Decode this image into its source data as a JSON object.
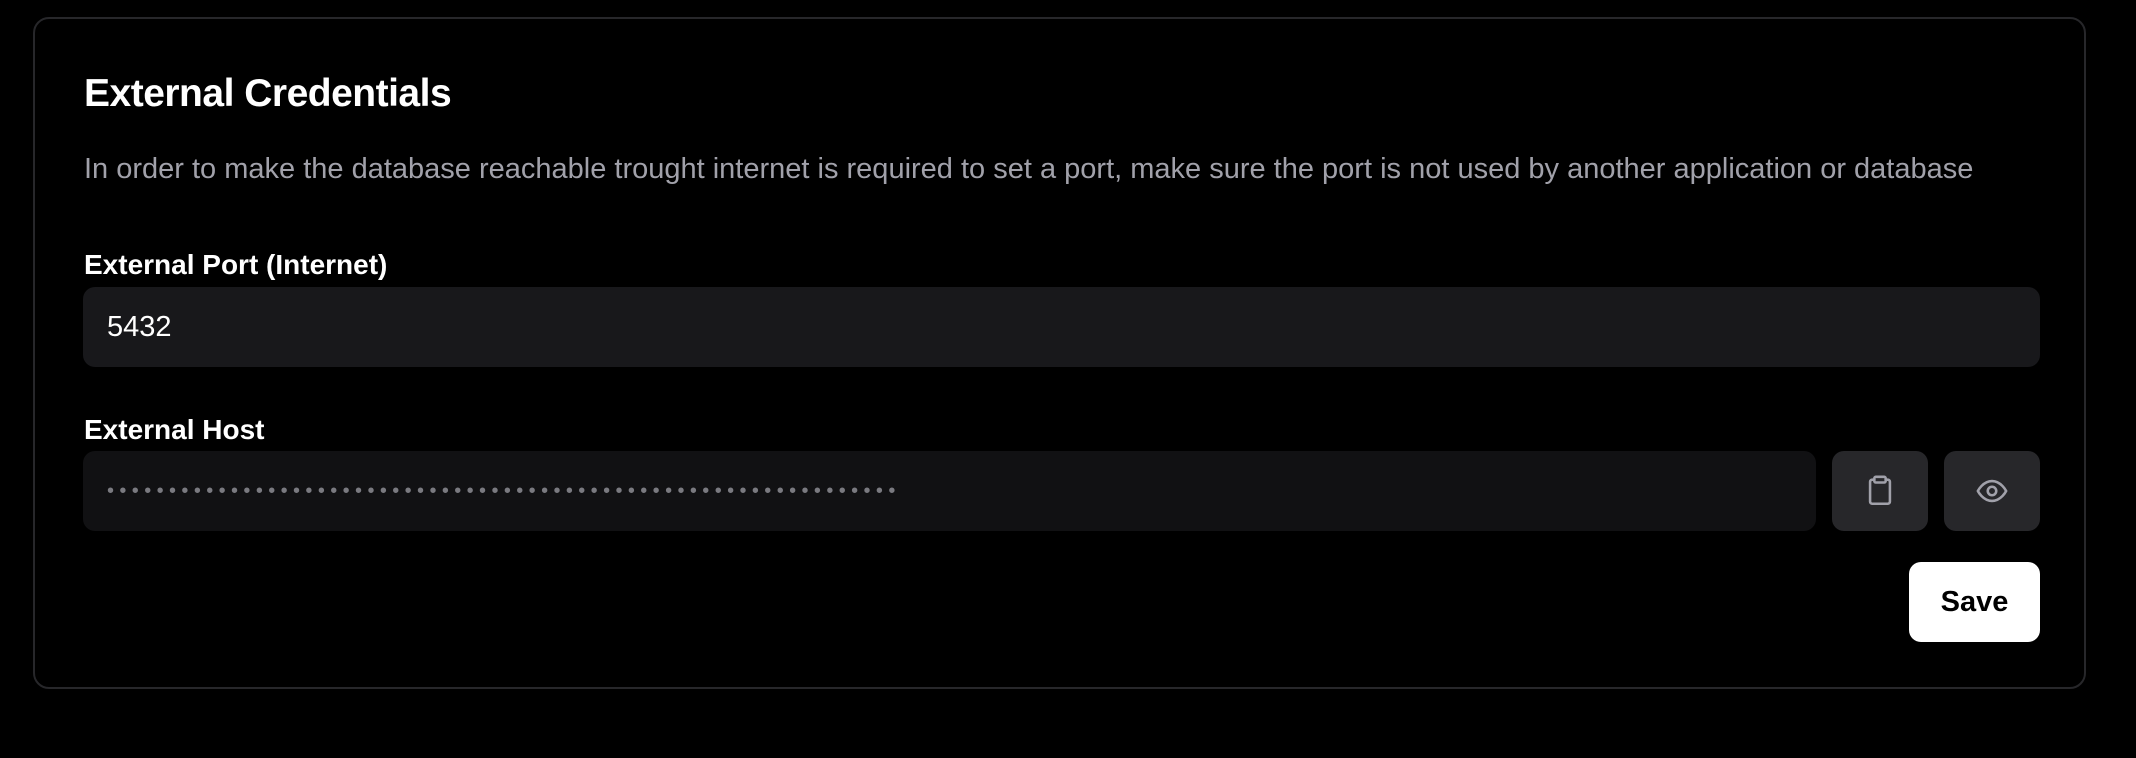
{
  "section": {
    "title": "External Credentials",
    "description": "In order to make the database reachable trought internet is required to set a port, make sure the port is not used by another application or database"
  },
  "fields": {
    "port": {
      "label": "External Port (Internet)",
      "value": "5432"
    },
    "host": {
      "label": "External Host",
      "masked_value": "••••••••••••••••••••••••••••••••••••••••••••••••••••••••••••••••",
      "copy_icon": "clipboard-icon",
      "reveal_icon": "eye-icon"
    }
  },
  "actions": {
    "save_label": "Save"
  },
  "colors": {
    "background": "#000000",
    "card_border": "#27272a",
    "muted_text": "#a1a1aa",
    "input_bg": "#18181b",
    "masked_input_bg": "#111113",
    "icon_button_bg": "#27272a",
    "primary_button_bg": "#ffffff",
    "primary_button_text": "#000000"
  }
}
